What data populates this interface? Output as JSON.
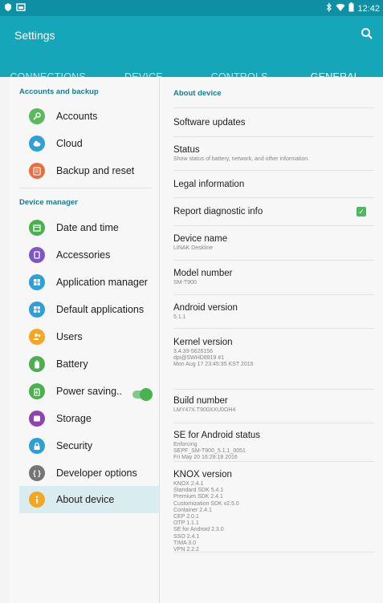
{
  "status_bar": {
    "time": "12:42",
    "icons_left": [
      "shield-icon",
      "gallery-icon"
    ],
    "icons_right": [
      "bluetooth-icon",
      "wifi-icon",
      "battery-icon"
    ]
  },
  "app_bar": {
    "title": "Settings",
    "search_icon": "search-icon"
  },
  "tabs": [
    {
      "label": "CONNECTIONS",
      "active": false
    },
    {
      "label": "DEVICE",
      "active": false
    },
    {
      "label": "CONTROLS",
      "active": false
    },
    {
      "label": "GENERAL",
      "active": true
    }
  ],
  "left": {
    "section1": "Accounts and backup",
    "section1_items": [
      {
        "label": "Accounts",
        "icon": "key-icon",
        "color": "#5cb85c"
      },
      {
        "label": "Cloud",
        "icon": "cloud-icon",
        "color": "#2f9fd8"
      },
      {
        "label": "Backup and reset",
        "icon": "backup-icon",
        "color": "#ef6b3a"
      }
    ],
    "section2": "Device manager",
    "section2_items": [
      {
        "label": "Date and time",
        "icon": "calendar-icon",
        "color": "#4caf50"
      },
      {
        "label": "Accessories",
        "icon": "accessories-icon",
        "color": "#7e57c2"
      },
      {
        "label": "Application manager",
        "icon": "grid-icon",
        "color": "#2f9fd8"
      },
      {
        "label": "Default applications",
        "icon": "default-apps-icon",
        "color": "#2f9fd8"
      },
      {
        "label": "Users",
        "icon": "users-icon",
        "color": "#f5a623"
      },
      {
        "label": "Battery",
        "icon": "battery-icon",
        "color": "#4caf50"
      },
      {
        "label": "Power saving..",
        "icon": "power-saving-icon",
        "color": "#4caf50"
      },
      {
        "label": "Storage",
        "icon": "storage-icon",
        "color": "#8e44ad"
      },
      {
        "label": "Security",
        "icon": "lock-icon",
        "color": "#2f9fd8"
      },
      {
        "label": "Developer options",
        "icon": "braces-icon",
        "color": "#757575"
      },
      {
        "label": "About device",
        "icon": "info-icon",
        "color": "#f5a623"
      }
    ],
    "power_saving_on": true,
    "selected": "About device"
  },
  "right": {
    "title": "About device",
    "items": [
      {
        "main": "Software updates",
        "sub": ""
      },
      {
        "main": "Status",
        "sub": "Show status of battery, network, and other information."
      },
      {
        "main": "Legal information",
        "sub": ""
      },
      {
        "main": "Report diagnostic info",
        "sub": "",
        "checked": true
      },
      {
        "main": "Device name",
        "sub": "LINAK Deskline"
      },
      {
        "main": "Model number",
        "sub": "SM-T900"
      },
      {
        "main": "Android version",
        "sub": "5.1.1"
      },
      {
        "main": "Kernel version",
        "sub": "3.4.39-5626156\ndpi@SWHD8919 #1\nMon Aug 17 23:45:35 KST 2015"
      },
      {
        "main": "Build number",
        "sub": "LMY47X.T900XXU0OH4"
      },
      {
        "main": "SE for Android status",
        "sub": "Enforcing\nSEPF_SM-T900_5.1.1_0051\nFri May 20 16:28:18 2016"
      },
      {
        "main": "KNOX version",
        "sub": "KNOX 2.4.1\nStandard SDK 5.4.1\nPremium SDK 2.4.1\nCustomization SDK v2.5.0\nContainer 2.4.1\nCEP 2.0.1\nOTP 1.1.1\nSE for Android 2.3.0\nSSO 2.4.1\nTIMA 3.0\nVPN 2.2.2"
      }
    ]
  }
}
